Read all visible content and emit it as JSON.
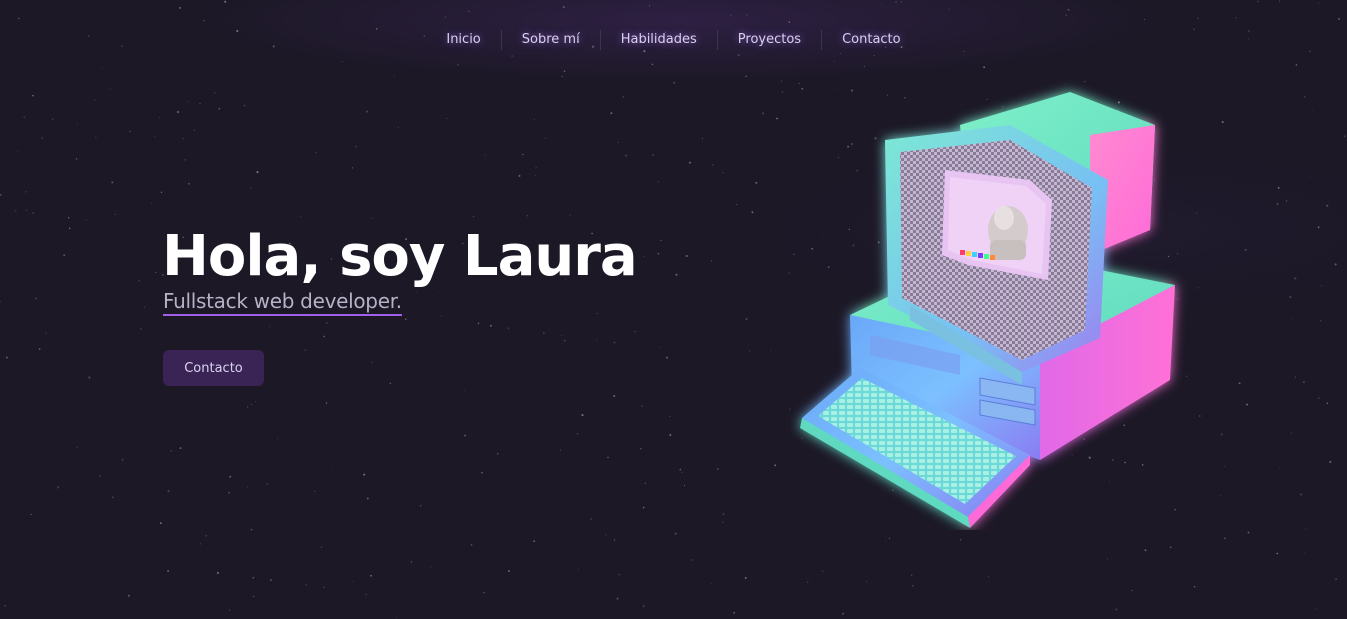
{
  "nav": {
    "items": [
      {
        "label": "Inicio"
      },
      {
        "label": "Sobre mí"
      },
      {
        "label": "Habilidades"
      },
      {
        "label": "Proyectos"
      },
      {
        "label": "Contacto"
      }
    ]
  },
  "hero": {
    "title": "Hola, soy Laura",
    "subtitle": "Fullstack web developer.",
    "cta_label": "Contacto"
  },
  "colors": {
    "background": "#1c1826",
    "accent": "#a060e8",
    "button": "#3a2456"
  },
  "illustration": {
    "icon": "retro-computer-illustration"
  }
}
